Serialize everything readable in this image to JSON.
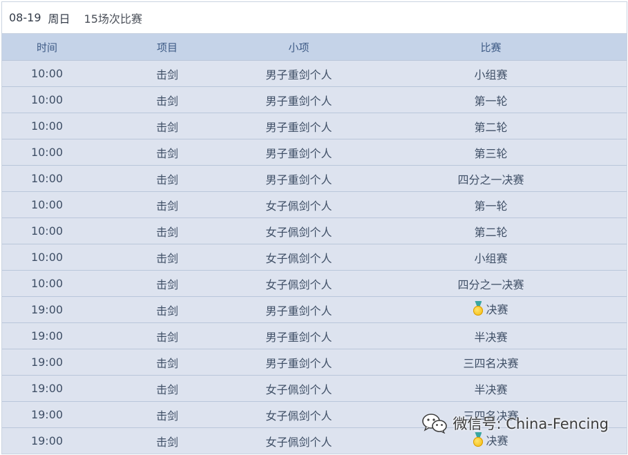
{
  "day": {
    "date": "08-19",
    "weekday": "周日",
    "count": "15场次比赛"
  },
  "columns": {
    "time": "时间",
    "sport": "项目",
    "event": "小项",
    "stage": "比赛"
  },
  "rows": [
    {
      "time": "10:00",
      "sport": "击剑",
      "event": "男子重剑个人",
      "stage": "小组赛",
      "medal": false
    },
    {
      "time": "10:00",
      "sport": "击剑",
      "event": "男子重剑个人",
      "stage": "第一轮",
      "medal": false
    },
    {
      "time": "10:00",
      "sport": "击剑",
      "event": "男子重剑个人",
      "stage": "第二轮",
      "medal": false
    },
    {
      "time": "10:00",
      "sport": "击剑",
      "event": "男子重剑个人",
      "stage": "第三轮",
      "medal": false
    },
    {
      "time": "10:00",
      "sport": "击剑",
      "event": "男子重剑个人",
      "stage": "四分之一决赛",
      "medal": false
    },
    {
      "time": "10:00",
      "sport": "击剑",
      "event": "女子佩剑个人",
      "stage": "第一轮",
      "medal": false
    },
    {
      "time": "10:00",
      "sport": "击剑",
      "event": "女子佩剑个人",
      "stage": "第二轮",
      "medal": false
    },
    {
      "time": "10:00",
      "sport": "击剑",
      "event": "女子佩剑个人",
      "stage": "小组赛",
      "medal": false
    },
    {
      "time": "10:00",
      "sport": "击剑",
      "event": "女子佩剑个人",
      "stage": "四分之一决赛",
      "medal": false
    },
    {
      "time": "19:00",
      "sport": "击剑",
      "event": "男子重剑个人",
      "stage": "决赛",
      "medal": true
    },
    {
      "time": "19:00",
      "sport": "击剑",
      "event": "男子重剑个人",
      "stage": "半决赛",
      "medal": false
    },
    {
      "time": "19:00",
      "sport": "击剑",
      "event": "男子重剑个人",
      "stage": "三四名决赛",
      "medal": false
    },
    {
      "time": "19:00",
      "sport": "击剑",
      "event": "女子佩剑个人",
      "stage": "半决赛",
      "medal": false
    },
    {
      "time": "19:00",
      "sport": "击剑",
      "event": "女子佩剑个人",
      "stage": "三四名决赛",
      "medal": false
    },
    {
      "time": "19:00",
      "sport": "击剑",
      "event": "女子佩剑个人",
      "stage": "决赛",
      "medal": true
    }
  ],
  "watermark": {
    "text": "微信号: China-Fencing",
    "icon": "wechat-icon"
  },
  "colors": {
    "header_bg": "#c5d3e8",
    "row_bg": "#dde3ef",
    "medal_gold": "#f2b700",
    "ribbon": "#3aa6a0"
  }
}
